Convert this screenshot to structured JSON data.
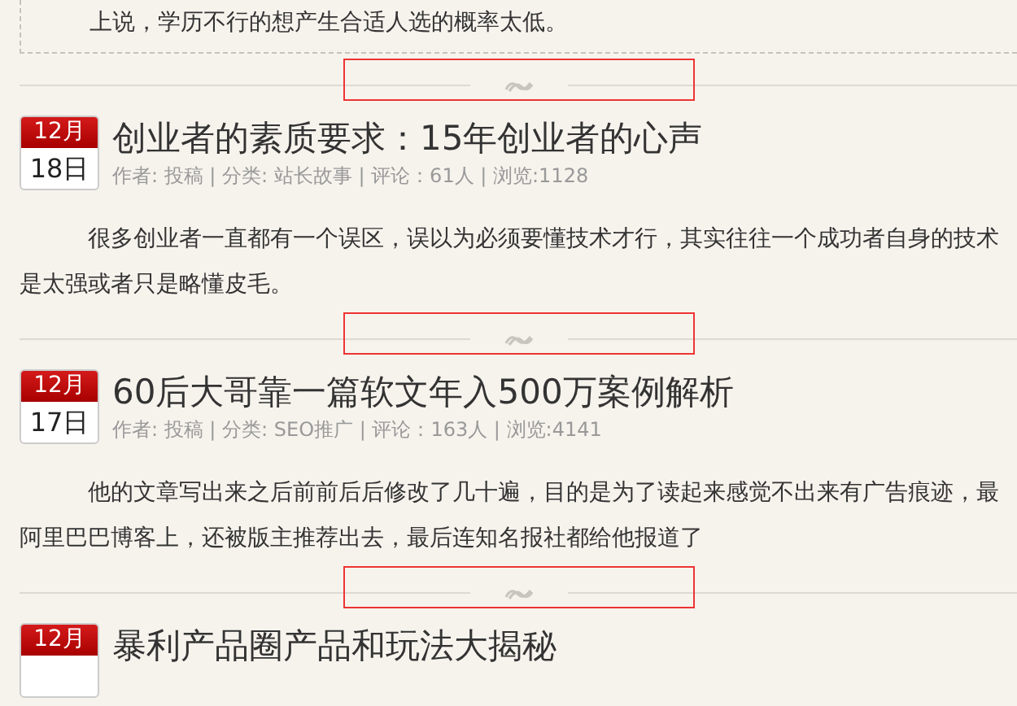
{
  "excerpt": {
    "text": "上说，学历不行的想产生合适人选的概率太低。"
  },
  "feed": [
    {
      "kind": "separator",
      "highlighted": true
    },
    {
      "kind": "post",
      "month": "12月",
      "day": "18日",
      "title": "创业者的素质要求：15年创业者的心声",
      "meta": "作者: 投稿 | 分类: 站长故事 | 评论：61人 | 浏览:1128",
      "lines": [
        "很多创业者一直都有一个误区，误以为必须要懂技术才行，其实往往一个成功者自身的技术",
        "是太强或者只是略懂皮毛。"
      ]
    },
    {
      "kind": "separator",
      "highlighted": true
    },
    {
      "kind": "post",
      "month": "12月",
      "day": "17日",
      "title": "60后大哥靠一篇软文年入500万案例解析",
      "meta": "作者: 投稿 | 分类: SEO推广 | 评论：163人 | 浏览:4141",
      "lines": [
        "他的文章写出来之后前前后后修改了几十遍，目的是为了读起来感觉不出来有广告痕迹，最",
        "阿里巴巴博客上，还被版主推荐出去，最后连知名报社都给他报道了"
      ]
    },
    {
      "kind": "separator",
      "highlighted": true
    },
    {
      "kind": "post",
      "month": "12月",
      "title": "暴利产品圈产品和玩法大揭秘"
    }
  ]
}
